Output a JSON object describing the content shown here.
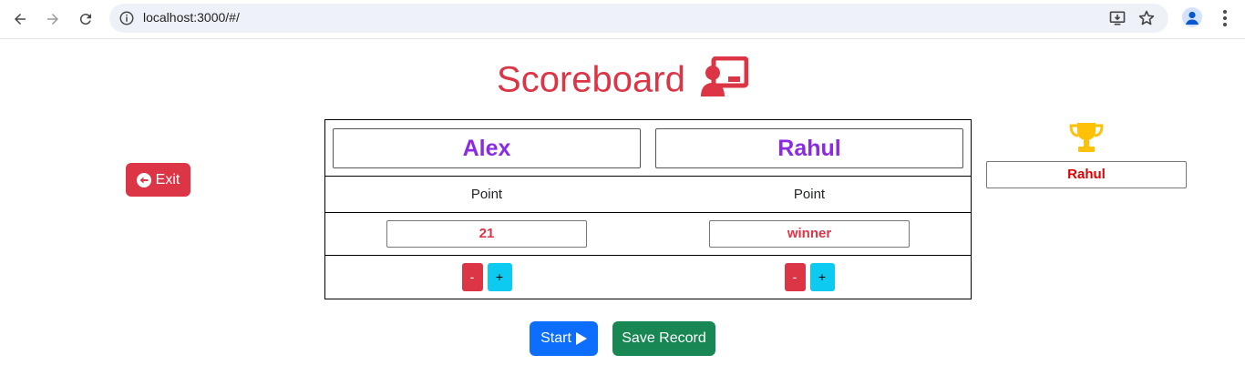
{
  "browser": {
    "url": "localhost:3000/#/",
    "icons": [
      "back-arrow-icon",
      "forward-arrow-icon",
      "reload-icon",
      "info-icon",
      "install-app-icon",
      "bookmark-star-icon",
      "profile-icon",
      "more-menu-icon"
    ]
  },
  "page": {
    "title": "Scoreboard",
    "title_icon": "chalkboard-user-icon",
    "accent_color": "#dc3545"
  },
  "exit": {
    "label": "Exit",
    "icon": "arrow-circle-left-icon",
    "color": "#dc3545"
  },
  "players": [
    {
      "name": "Alex",
      "point_label": "Point",
      "score": "21",
      "minus_label": "-",
      "plus_label": "+"
    },
    {
      "name": "Rahul",
      "point_label": "Point",
      "score": "winner",
      "minus_label": "-",
      "plus_label": "+"
    }
  ],
  "winner": {
    "icon": "trophy-icon",
    "name": "Rahul",
    "color": "#e00000"
  },
  "actions": {
    "start_label": "Start",
    "start_icon": "play-icon",
    "save_label": "Save Record"
  }
}
